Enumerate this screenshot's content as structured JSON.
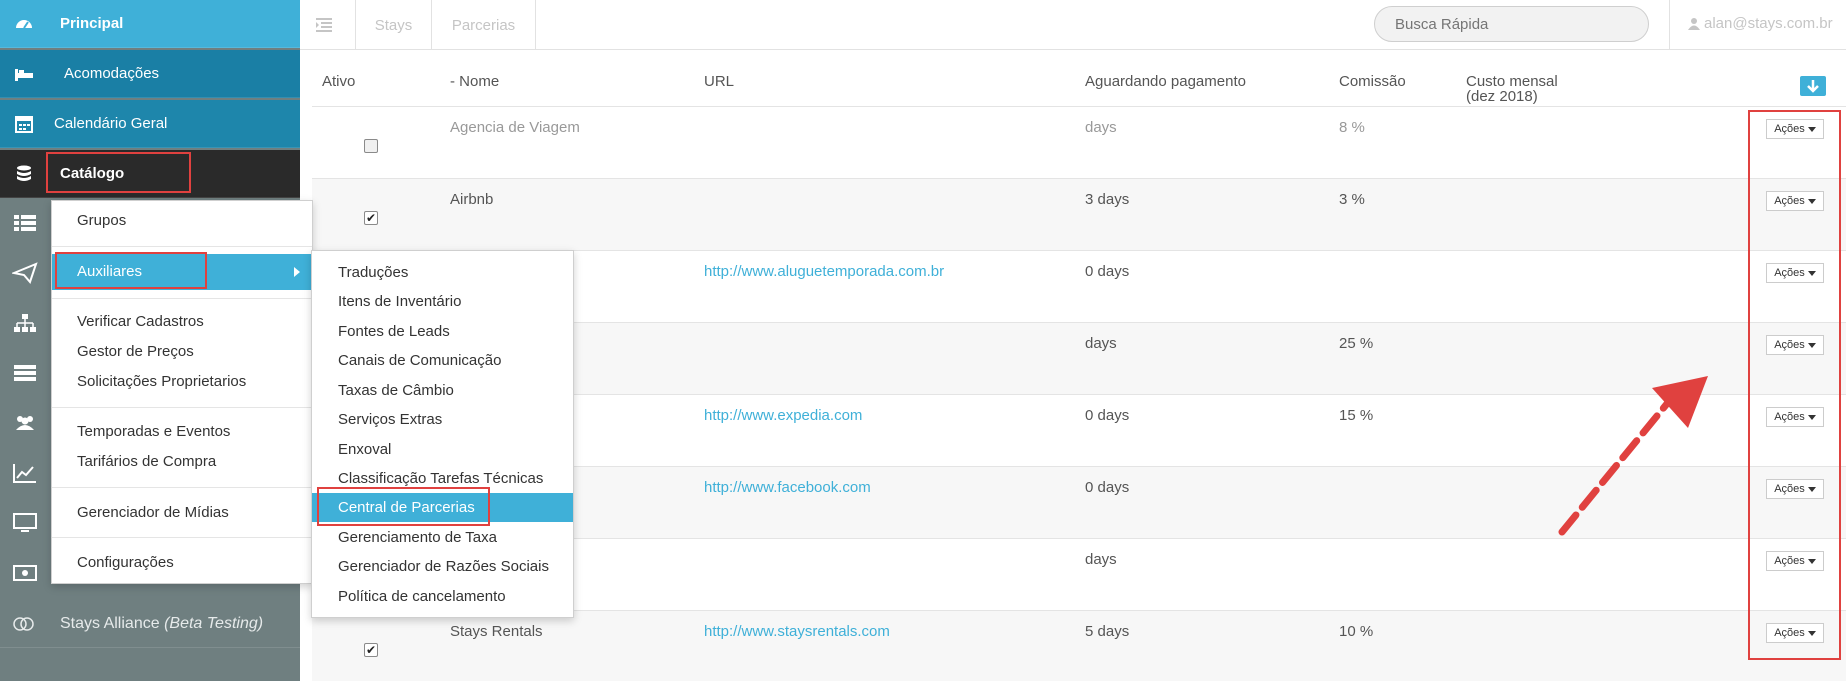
{
  "sidebar": {
    "principal": "Principal",
    "acomodacoes": "Acomodações",
    "calendario": "Calendário Geral",
    "catalogo": "Catálogo",
    "alliance_name": "Stays Alliance",
    "alliance_tag": "(Beta Testing)",
    "colors": {
      "active": "#3fb0d8",
      "section": "#1a7fa5",
      "selected": "#2a2a2a",
      "bg": "#6f7f80"
    }
  },
  "topbar": {
    "tab_stays": "Stays",
    "tab_parcerias": "Parcerias",
    "search_placeholder": "Busca Rápida",
    "user_email": "alan@stays.com.br"
  },
  "table": {
    "headers": {
      "ativo": "Ativo",
      "nome": "- Nome",
      "url": "URL",
      "aguardando": "Aguardando pagamento",
      "comissao": "Comissão",
      "custo_line1": "Custo mensal",
      "custo_line2": "(dez 2018)"
    },
    "acoes_label": "Ações",
    "rows": [
      {
        "checked": false,
        "nome": "Agencia de Viagem",
        "url": "",
        "aguardando": "days",
        "comissao": "8 %"
      },
      {
        "checked": true,
        "nome": "Airbnb",
        "url": "",
        "aguardando": "3 days",
        "comissao": "3 %"
      },
      {
        "checked": false,
        "nome": "",
        "url": "http://www.aluguetemporada.com.br",
        "aguardando": "0 days",
        "comissao": ""
      },
      {
        "checked": false,
        "nome": "",
        "url": "",
        "aguardando": "days",
        "comissao": "25 %"
      },
      {
        "checked": false,
        "nome": "",
        "url": "http://www.expedia.com",
        "aguardando": "0 days",
        "comissao": "15 %"
      },
      {
        "checked": false,
        "nome": "",
        "url": "http://www.facebook.com",
        "aguardando": "0 days",
        "comissao": ""
      },
      {
        "checked": false,
        "nome": "",
        "url": "",
        "aguardando": "days",
        "comissao": ""
      },
      {
        "checked": true,
        "nome": "Stays Rentals",
        "url": "http://www.staysrentals.com",
        "aguardando": "5 days",
        "comissao": "10 %"
      }
    ]
  },
  "catalog_menu": {
    "items": [
      "Grupos",
      "Auxiliares",
      "Verificar Cadastros",
      "Gestor de Preços",
      "Solicitações Proprietarios",
      "Temporadas e Eventos",
      "Tarifários de Compra",
      "Gerenciador de Mídias",
      "Configurações"
    ]
  },
  "aux_menu": {
    "items": [
      "Traduções",
      "Itens de Inventário",
      "Fontes de Leads",
      "Canais de Comunicação",
      "Taxas de Câmbio",
      "Serviços Extras",
      "Enxoval",
      "Classificação Tarefas Técnicas",
      "Central de Parcerias",
      "Gerenciamento de Taxa",
      "Gerenciador de Razões Sociais",
      "Política de cancelamento"
    ]
  },
  "annotation_color": "#e0413f"
}
